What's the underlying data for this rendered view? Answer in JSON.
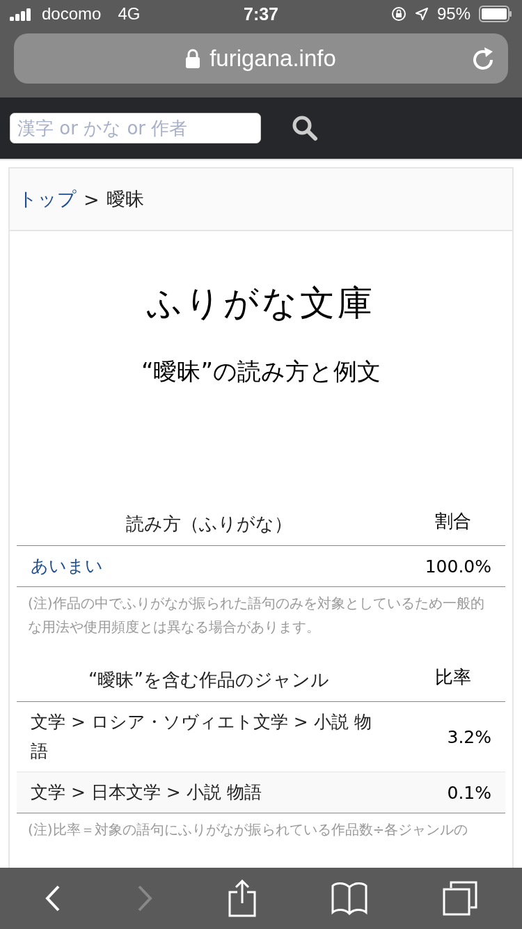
{
  "status_bar": {
    "carrier": "docomo",
    "network": "4G",
    "time": "7:37",
    "battery": "95%"
  },
  "url_bar": {
    "url": "furigana.info"
  },
  "site_header": {
    "search": {
      "placeholder": "漢字 or かな or 作者"
    }
  },
  "breadcrumb": {
    "separator": ">",
    "items": [
      {
        "label": "トップ",
        "link": true
      },
      {
        "label": "曖昧",
        "link": false
      }
    ]
  },
  "site_title": "ふりがな文庫",
  "page_title": "“曖昧”の読み方と例文",
  "readings_table": {
    "columns": [
      "読み方（ふりがな）",
      "割合"
    ],
    "rows": [
      {
        "reading": "あいまい",
        "ratio": "100.0%"
      }
    ],
    "note": "(注)作品の中でふりがなが振られた語句のみを対象としているため一般的な用法や使用頻度とは異なる場合があります。"
  },
  "genres_table": {
    "columns": [
      "“曖昧”を含む作品のジャンル",
      "比率"
    ],
    "rows": [
      {
        "genre": "文学 > ロシア・ソヴィエト文学 > 小説 物語",
        "ratio": "3.2%"
      },
      {
        "genre": "文学 > 日本文学 > 小説 物語",
        "ratio": "0.1%"
      }
    ],
    "note": "(注)比率＝対象の語句にふりがなが振られている作品数÷各ジャンルの"
  },
  "toolbar": {
    "back_disabled": false,
    "forward_disabled": true
  }
}
